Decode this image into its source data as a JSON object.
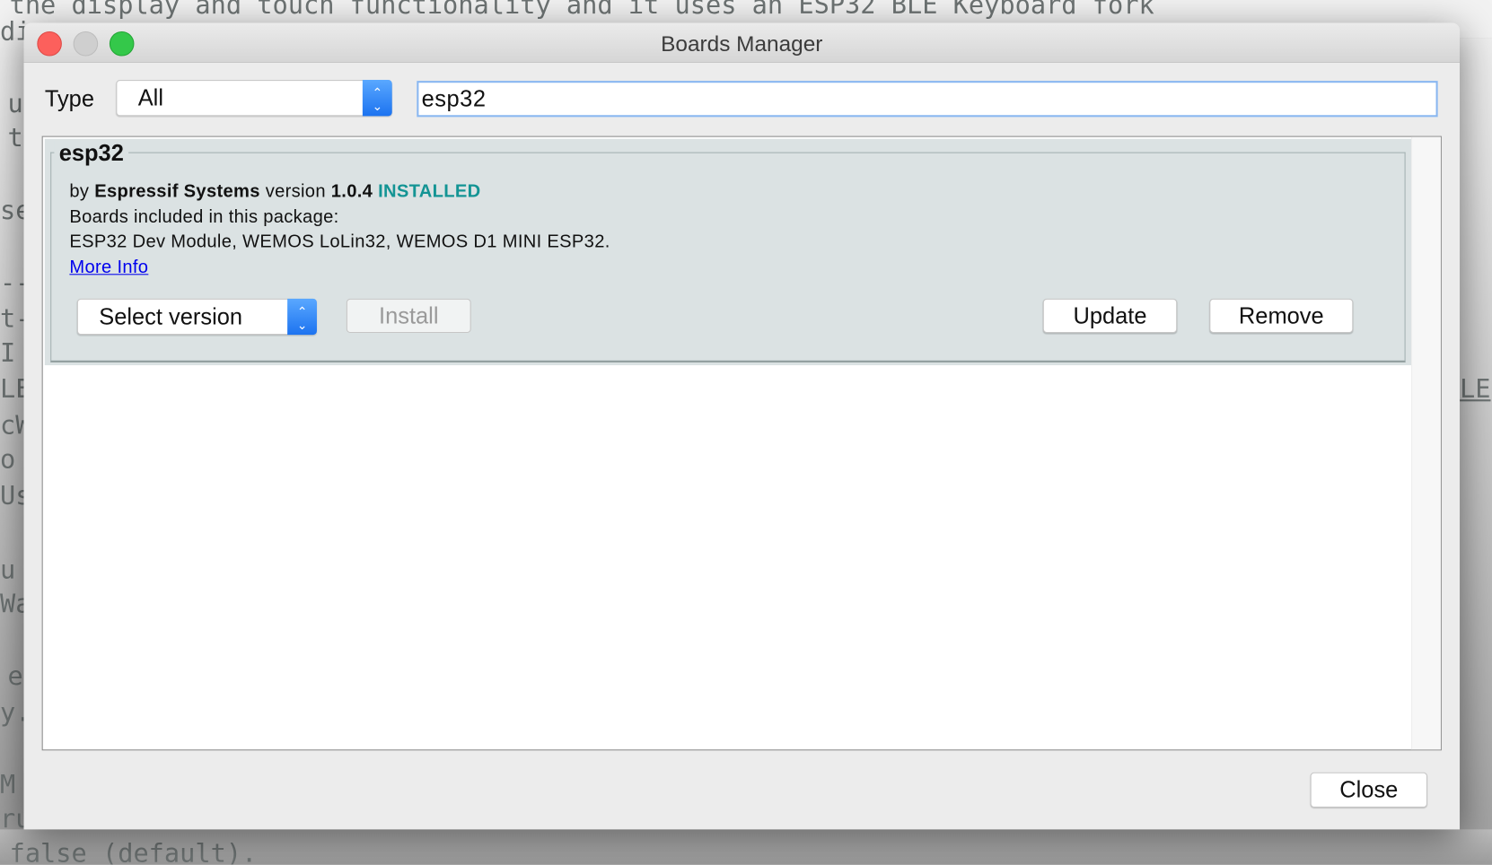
{
  "background_editor": {
    "lines": [
      "the display and touch functionality and it uses an ESP32 BLE Keyboard fork",
      "di",
      "u",
      "t",
      "se",
      "--",
      "t-",
      "I",
      "LE",
      "cW",
      "o",
      "Us",
      "u",
      "Wa",
      "e",
      "y.",
      "M",
      "ru",
      "false (default)."
    ],
    "right_fragment": "LE"
  },
  "window": {
    "title": "Boards Manager"
  },
  "filter": {
    "type_label": "Type",
    "type_value": "All",
    "search_value": "esp32"
  },
  "package": {
    "name": "esp32",
    "by_label": "by",
    "author": "Espressif Systems",
    "version_label": "version",
    "version": "1.0.4",
    "status": "INSTALLED",
    "boards_label": "Boards included in this package:",
    "boards": "ESP32 Dev Module, WEMOS LoLin32, WEMOS D1 MINI ESP32.",
    "more_info": "More Info",
    "select_version": "Select version",
    "install": "Install",
    "update": "Update",
    "remove": "Remove"
  },
  "footer": {
    "close": "Close"
  },
  "colors": {
    "installed": "#139494",
    "link": "#0000ee",
    "accent": "#1c73f0"
  }
}
